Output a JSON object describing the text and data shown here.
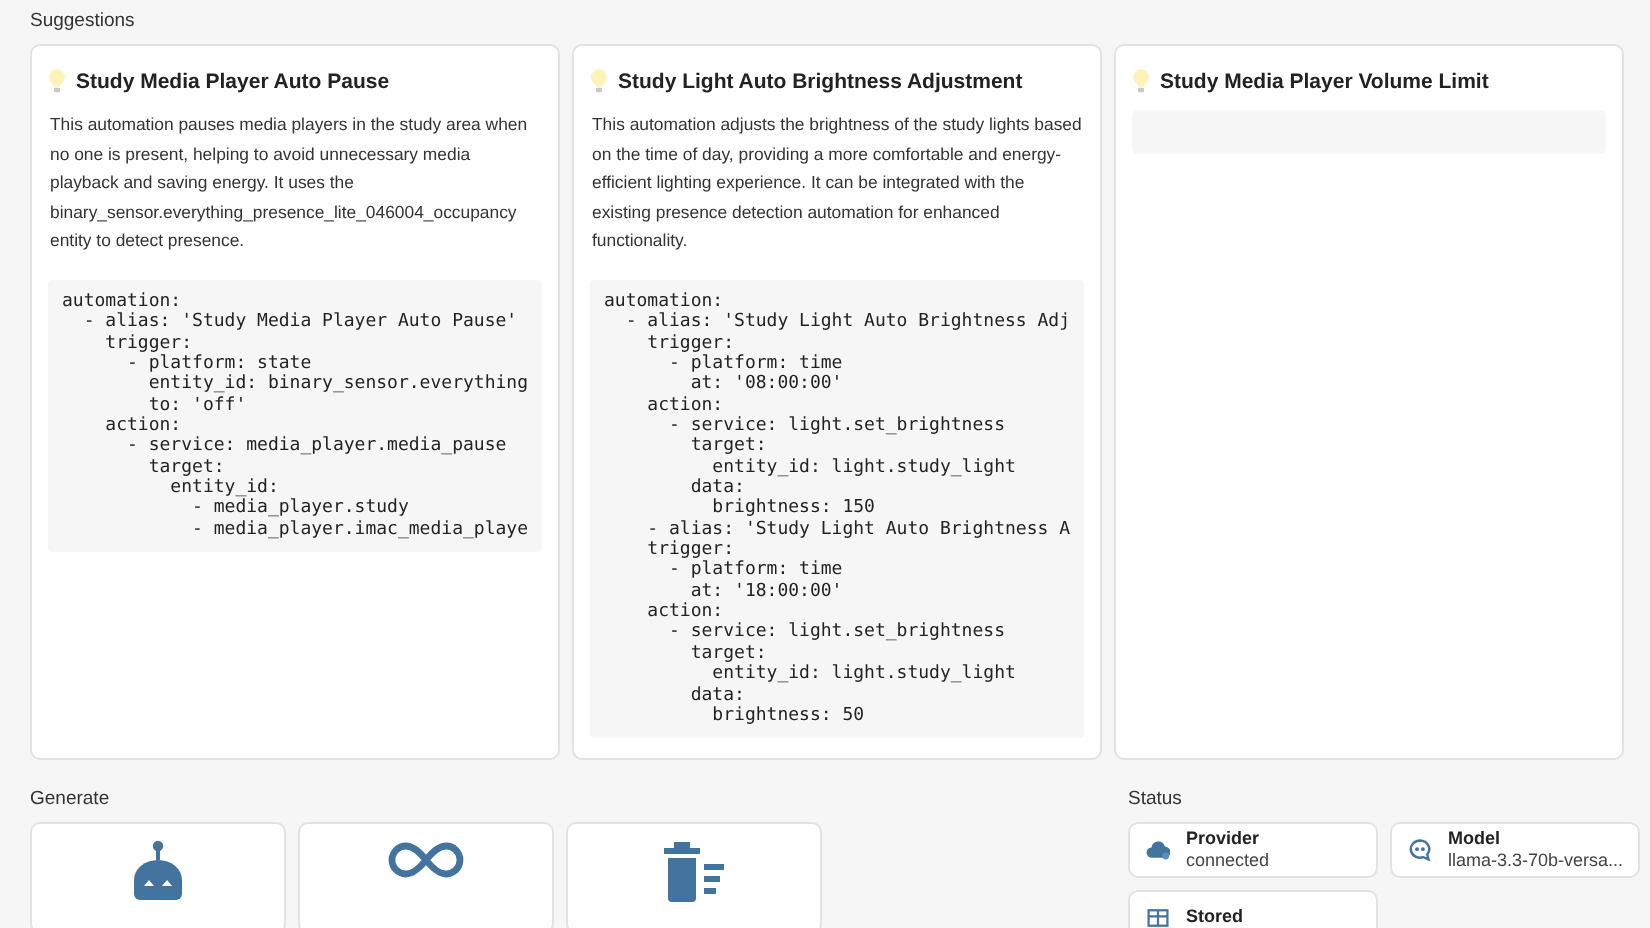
{
  "suggestions": {
    "heading": "Suggestions",
    "cards": [
      {
        "title": "Study Media Player Auto Pause",
        "description": "This automation pauses media players in the study area when no one is present, helping to avoid unnecessary media playback and saving energy. It uses the binary_sensor.everything_presence_lite_046004_occupancy entity to detect presence.",
        "code": "automation:\n  - alias: 'Study Media Player Auto Pause'\n    trigger:\n      - platform: state\n        entity_id: binary_sensor.everything\n        to: 'off'\n    action:\n      - service: media_player.media_pause\n        target:\n          entity_id:\n            - media_player.study\n            - media_player.imac_media_playe"
      },
      {
        "title": "Study Light Auto Brightness Adjustment",
        "description": "This automation adjusts the brightness of the study lights based on the time of day, providing a more comfortable and energy-efficient lighting experience. It can be integrated with the existing presence detection automation for enhanced functionality.",
        "code": "automation:\n  - alias: 'Study Light Auto Brightness Adj\n    trigger:\n      - platform: time\n        at: '08:00:00'\n    action:\n      - service: light.set_brightness\n        target:\n          entity_id: light.study_light\n        data:\n          brightness: 150\n    - alias: 'Study Light Auto Brightness A\n    trigger:\n      - platform: time\n        at: '18:00:00'\n    action:\n      - service: light.set_brightness\n        target:\n          entity_id: light.study_light\n        data:\n          brightness: 50"
      },
      {
        "title": "Study Media Player Volume Limit"
      }
    ]
  },
  "generate": {
    "heading": "Generate",
    "buttons": [
      {
        "kind": "robot"
      },
      {
        "kind": "infinity"
      },
      {
        "kind": "clear"
      }
    ]
  },
  "status": {
    "heading": "Status",
    "items": [
      {
        "kind": "provider",
        "label": "Provider",
        "value": "connected"
      },
      {
        "kind": "model",
        "label": "Model",
        "value": "llama-3.3-70b-versa..."
      },
      {
        "kind": "stored",
        "label": "Stored"
      }
    ]
  }
}
